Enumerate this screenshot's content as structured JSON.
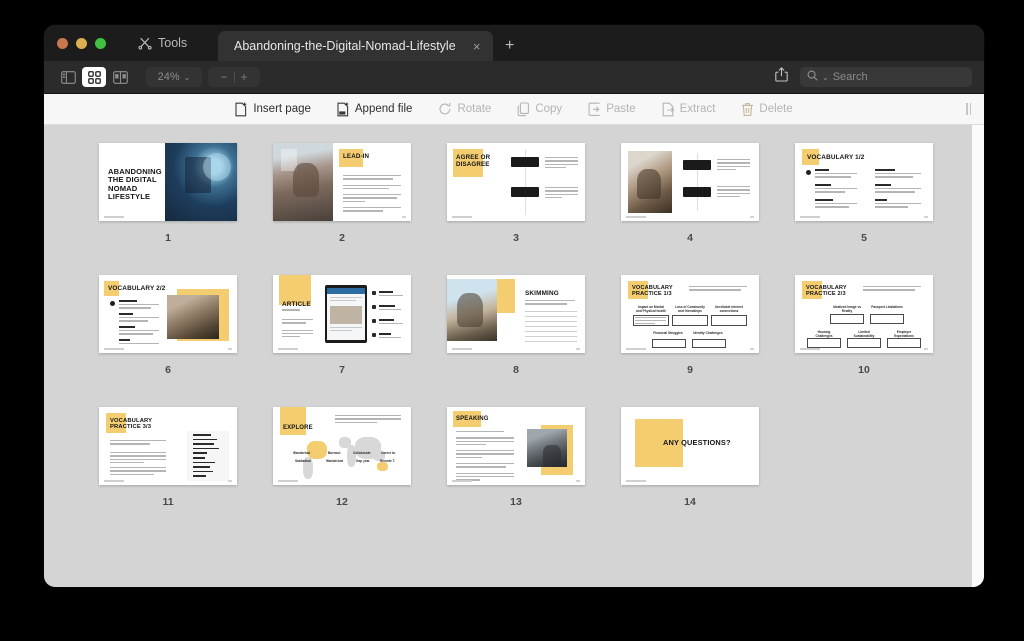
{
  "window": {
    "traffic_lights": [
      "close",
      "minimize",
      "maximize"
    ],
    "tools_label": "Tools",
    "tools_icon": "scissors-icon",
    "tab_title": "Abandoning-the-Digital-Nomad-Lifestyle",
    "tab_close_glyph": "×",
    "new_tab_glyph": "+"
  },
  "toolbar": {
    "view_modes": [
      {
        "name": "sidebar-view",
        "icon": "sidebar-panel-icon",
        "active": false
      },
      {
        "name": "grid-view",
        "icon": "grid-thumbnail-icon",
        "active": true
      },
      {
        "name": "two-page-view",
        "icon": "two-page-spread-icon",
        "active": false
      }
    ],
    "zoom_level": "24%",
    "zoom_chevron": "⌄",
    "zoom_out_glyph": "−",
    "zoom_in_glyph": "+",
    "share_icon": "share-export-icon",
    "search_icon": "magnifier-icon",
    "search_chevron": "⌄",
    "search_placeholder": "Search",
    "search_value": ""
  },
  "actionbar": {
    "actions": [
      {
        "label": "Insert page",
        "icon": "insert-page-icon",
        "enabled": true
      },
      {
        "label": "Append file",
        "icon": "append-pdf-icon",
        "enabled": true
      },
      {
        "label": "Rotate",
        "icon": "rotate-icon",
        "enabled": false
      },
      {
        "label": "Copy",
        "icon": "copy-icon",
        "enabled": false
      },
      {
        "label": "Paste",
        "icon": "paste-icon",
        "enabled": false
      },
      {
        "label": "Extract",
        "icon": "extract-icon",
        "enabled": false
      },
      {
        "label": "Delete",
        "icon": "trash-icon",
        "enabled": false
      }
    ],
    "grabber_icon": "resize-grabber-icon"
  },
  "document": {
    "accent_yellow": "#f3cd70",
    "canvas_bg": "#d4d4d4",
    "total_pages": 14,
    "pages": [
      {
        "number": "1",
        "title": "ABANDONING THE DIGITAL NOMAD LIFESTYLE",
        "layout": "cover"
      },
      {
        "number": "2",
        "title": "LEAD-IN",
        "layout": "photo-left-list-right"
      },
      {
        "number": "3",
        "title": "AGREE OR DISAGREE",
        "layout": "title-left-dark-cards"
      },
      {
        "number": "4",
        "title": "",
        "layout": "photo-left-dark-cards"
      },
      {
        "number": "5",
        "title": "VOCABULARY 1/2",
        "layout": "vocab-two-column"
      },
      {
        "number": "6",
        "title": "VOCABULARY 2/2",
        "layout": "vocab-with-photo"
      },
      {
        "number": "7",
        "title": "ARTICLE",
        "layout": "tablet-mockup"
      },
      {
        "number": "8",
        "title": "SKIMMING",
        "layout": "photo-left-lines-right"
      },
      {
        "number": "9",
        "title": "VOCABULARY PRACTICE 1/3",
        "layout": "five-boxes"
      },
      {
        "number": "10",
        "title": "VOCABULARY PRACTICE 2/3",
        "layout": "five-boxes"
      },
      {
        "number": "11",
        "title": "VOCABULARY PRACTICE 3/3",
        "layout": "text-with-wordlist"
      },
      {
        "number": "12",
        "title": "EXPLORE",
        "layout": "world-map"
      },
      {
        "number": "13",
        "title": "SPEAKING",
        "layout": "list-left-photo-right"
      },
      {
        "number": "14",
        "title": "ANY QUESTIONS?",
        "layout": "closing"
      }
    ]
  }
}
